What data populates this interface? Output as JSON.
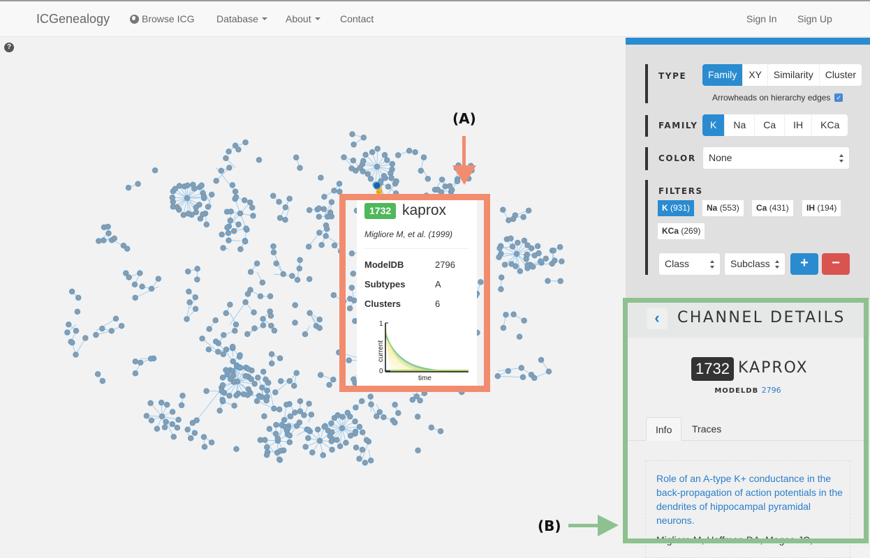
{
  "navbar": {
    "brand": "ICGenealogy",
    "items": [
      {
        "label": "Browse ICG",
        "icon": "globe-icon"
      },
      {
        "label": "Database",
        "dropdown": true
      },
      {
        "label": "About",
        "dropdown": true
      },
      {
        "label": "Contact"
      }
    ],
    "right": [
      "Sign In",
      "Sign Up"
    ]
  },
  "help_icon": "?",
  "controls": {
    "type": {
      "label": "TYPE",
      "options": [
        "Family",
        "XY",
        "Similarity",
        "Cluster"
      ],
      "selected": "Family",
      "arrowheads_label": "Arrowheads on hierarchy edges",
      "arrowheads_checked": true
    },
    "family": {
      "label": "FAMILY",
      "options": [
        "K",
        "Na",
        "Ca",
        "IH",
        "KCa"
      ],
      "selected": "K"
    },
    "color": {
      "label": "COLOR",
      "value": "None"
    },
    "filters": {
      "label": "FILTERS",
      "tags": [
        {
          "name": "K",
          "count": "(931)",
          "active": true
        },
        {
          "name": "Na",
          "count": "(553)",
          "active": false
        },
        {
          "name": "Ca",
          "count": "(431)",
          "active": false
        },
        {
          "name": "IH",
          "count": "(194)",
          "active": false
        },
        {
          "name": "KCa",
          "count": "(269)",
          "active": false
        }
      ],
      "class_select": "Class",
      "subclass_select": "Subclass",
      "add_label": "+",
      "remove_label": "−"
    }
  },
  "tooltip": {
    "id": "1732",
    "name": "kaprox",
    "authors": "Migliore M, et al. (1999)",
    "rows": [
      {
        "key": "ModelDB",
        "value": "2796"
      },
      {
        "key": "Subtypes",
        "value": "A"
      },
      {
        "key": "Clusters",
        "value": "6"
      }
    ],
    "chart": {
      "ylabel": "current",
      "xlabel": "time",
      "ymax_label": "1",
      "ymin_label": "0"
    }
  },
  "details": {
    "title": "CHANNEL DETAILS",
    "back_icon": "‹",
    "id": "1732",
    "name": "KAPROX",
    "modeldb_label": "MODELDB",
    "modeldb_id": "2796",
    "tabs": [
      "Info",
      "Traces"
    ],
    "active_tab": "Info",
    "paper_title": "Role of an A-type K+ conductance in the back-propagation of action potentials in the dendrites of hippocampal pyramidal neurons.",
    "paper_authors": "Migliore M, Hoffman DA, Magee JC,"
  },
  "annotations": {
    "a_label": "(A)",
    "b_label": "(B)",
    "a_color": "#f28c6f",
    "b_color": "#8ec18f"
  },
  "colors": {
    "accent": "#2a8bd0",
    "danger": "#d9534f",
    "node_fill": "#999999",
    "node_stroke": "#5aa0d8",
    "edge": "#9cc8ea",
    "badge_green": "#4fb85a"
  }
}
